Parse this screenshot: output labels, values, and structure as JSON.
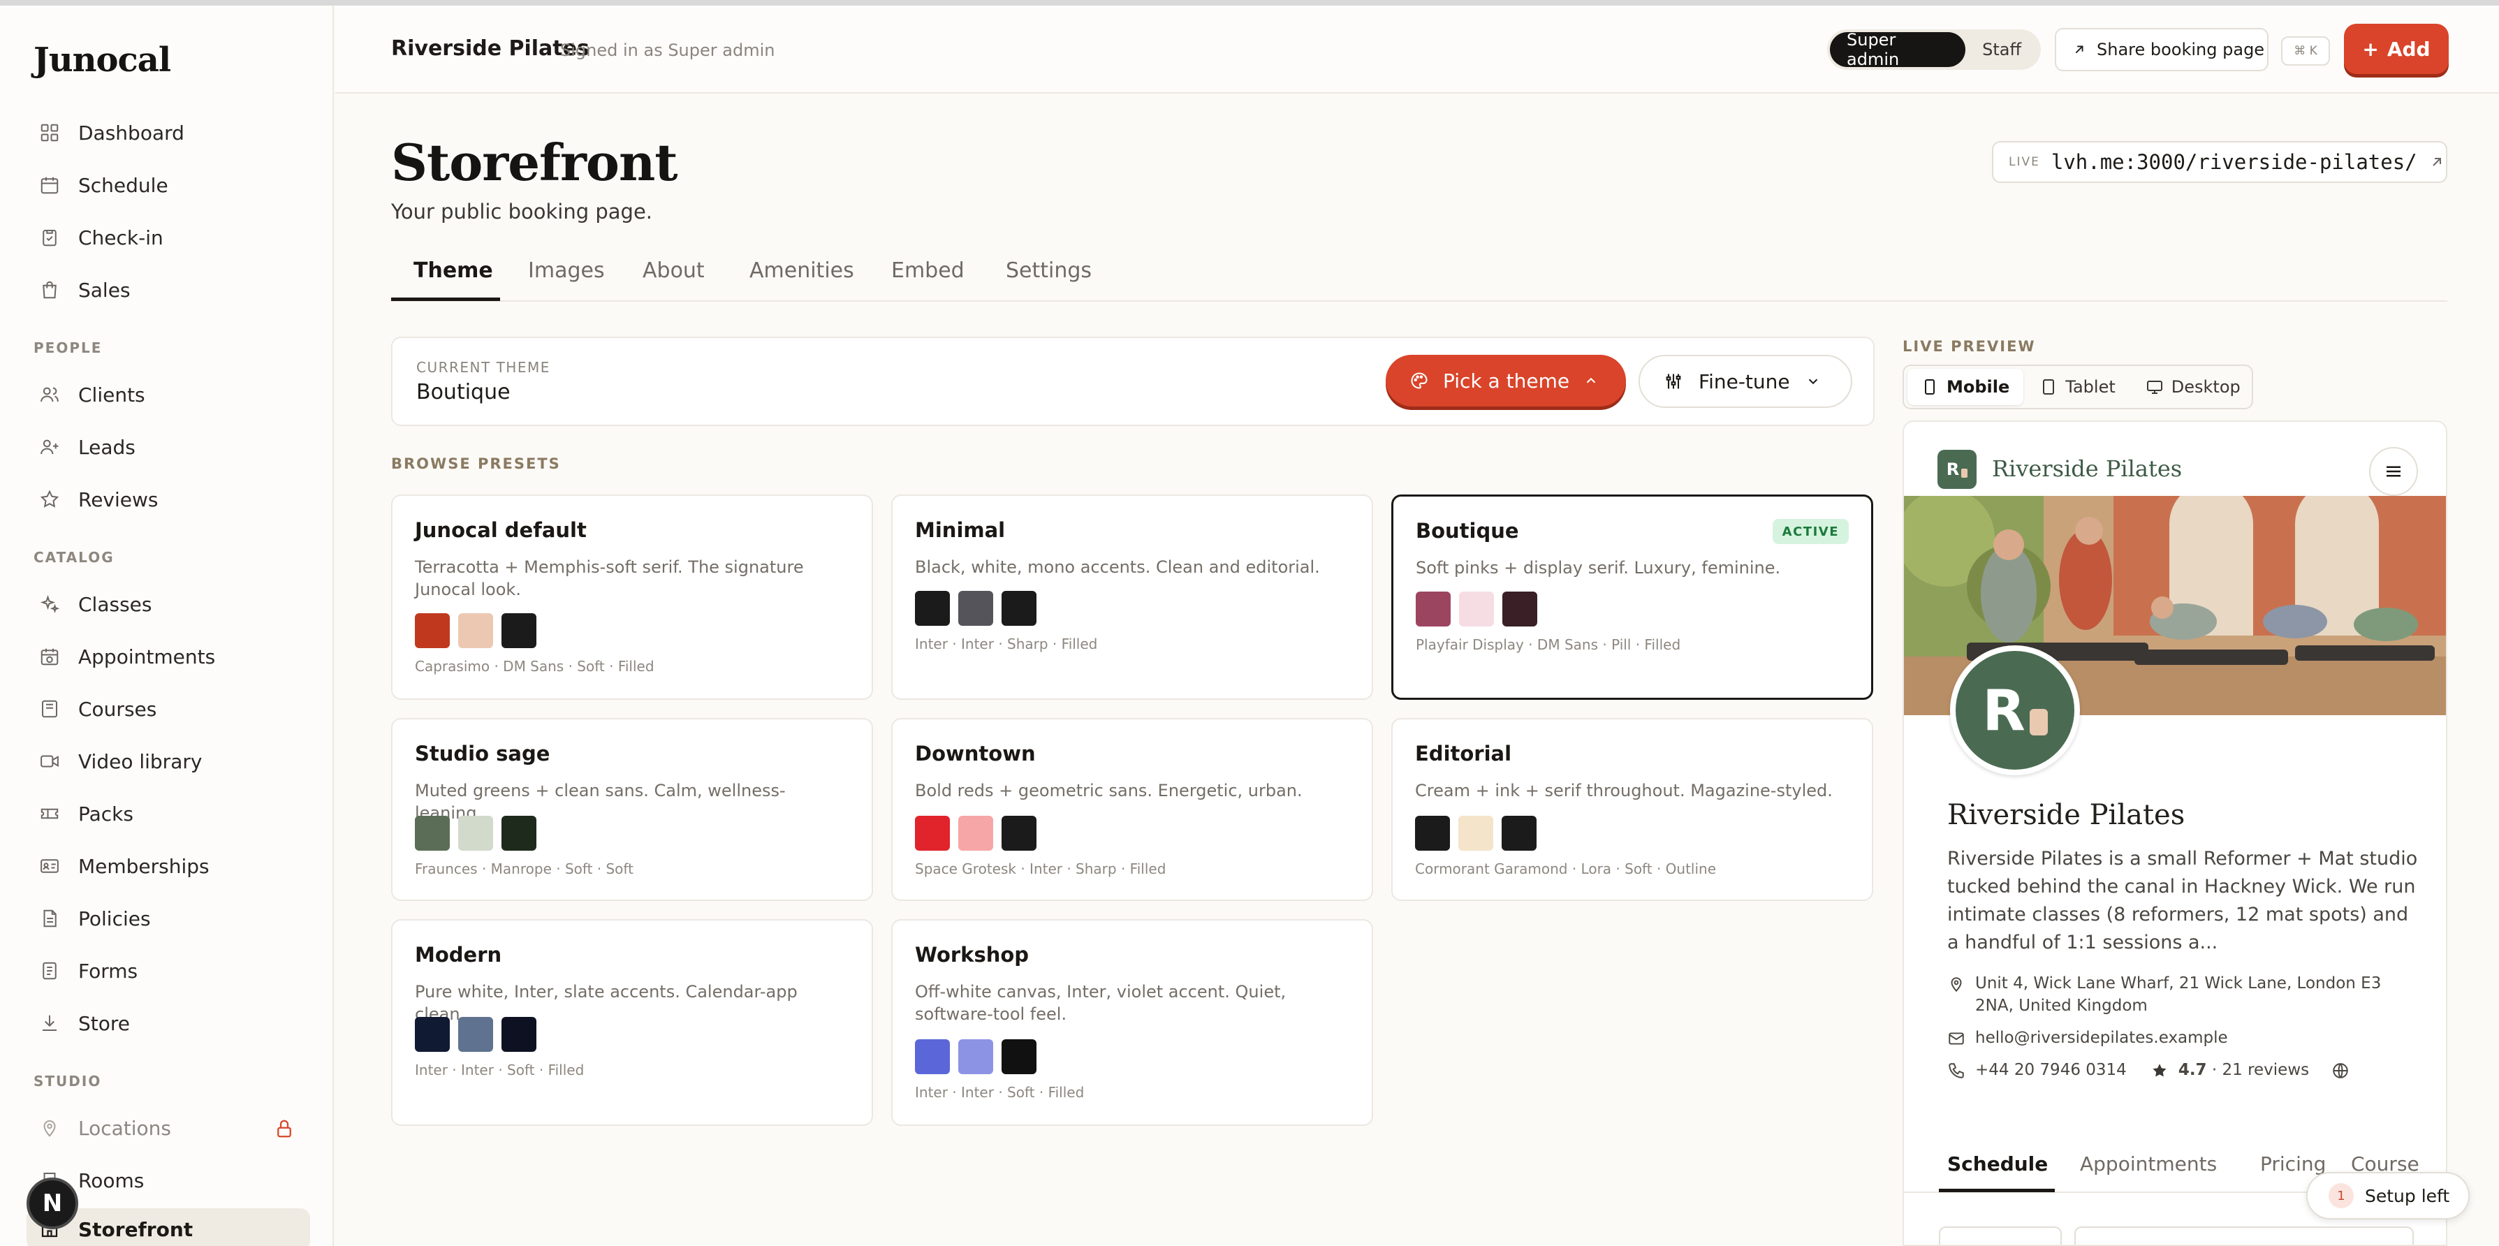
{
  "brand": {
    "logo": "Junocal"
  },
  "sidebar": {
    "items_main": [
      {
        "label": "Dashboard",
        "icon": "dashboard-icon"
      },
      {
        "label": "Schedule",
        "icon": "calendar-icon"
      },
      {
        "label": "Check-in",
        "icon": "clipboard-check-icon"
      },
      {
        "label": "Sales",
        "icon": "shopping-bag-icon"
      }
    ],
    "section_people": "PEOPLE",
    "items_people": [
      {
        "label": "Clients",
        "icon": "users-icon"
      },
      {
        "label": "Leads",
        "icon": "user-plus-icon"
      },
      {
        "label": "Reviews",
        "icon": "star-icon"
      }
    ],
    "section_catalog": "CATALOG",
    "items_catalog": [
      {
        "label": "Classes",
        "icon": "sparkles-icon"
      },
      {
        "label": "Appointments",
        "icon": "calendar-clock-icon"
      },
      {
        "label": "Courses",
        "icon": "book-icon"
      },
      {
        "label": "Video library",
        "icon": "video-icon"
      },
      {
        "label": "Packs",
        "icon": "ticket-icon"
      },
      {
        "label": "Memberships",
        "icon": "id-card-icon"
      },
      {
        "label": "Policies",
        "icon": "document-icon"
      },
      {
        "label": "Forms",
        "icon": "form-icon"
      },
      {
        "label": "Store",
        "icon": "download-icon"
      }
    ],
    "section_studio": "STUDIO",
    "items_studio": [
      {
        "label": "Locations",
        "icon": "map-pin-icon"
      },
      {
        "label": "Rooms",
        "icon": "door-icon"
      },
      {
        "label": "Storefront",
        "icon": "storefront-icon"
      }
    ],
    "fab_letter": "N"
  },
  "header": {
    "org_name": "Riverside Pilates",
    "signed_in": "Signed in as Super admin",
    "roles": [
      "Super admin",
      "Staff"
    ],
    "share_label": "Share booking page",
    "shortcut": "⌘ K",
    "add_label": "Add"
  },
  "page": {
    "title": "Storefront",
    "subtitle": "Your public booking page.",
    "live_tag": "LIVE",
    "live_url": "lvh.me:3000/riverside-pilates/"
  },
  "tabs": [
    "Theme",
    "Images",
    "About",
    "Amenities",
    "Embed",
    "Settings"
  ],
  "current_theme": {
    "label": "CURRENT THEME",
    "value": "Boutique",
    "pick_label": "Pick a theme",
    "finetune_label": "Fine-tune"
  },
  "browse_label": "BROWSE PRESETS",
  "presets": [
    {
      "name": "Junocal default",
      "desc": "Terracotta + Memphis-soft serif. The signature Junocal look.",
      "swatches": [
        "#c0391f",
        "#ecc8b3",
        "#1b1b1b"
      ],
      "meta": [
        "Caprasimo",
        "DM Sans",
        "Soft",
        "Filled"
      ]
    },
    {
      "name": "Minimal",
      "desc": "Black, white, mono accents. Clean and editorial.",
      "swatches": [
        "#1b1b1b",
        "#55545b",
        "#1b1b1b"
      ],
      "meta": [
        "Inter",
        "Inter",
        "Sharp",
        "Filled"
      ]
    },
    {
      "name": "Boutique",
      "desc": "Soft pinks + display serif. Luxury, feminine.",
      "swatches": [
        "#9c4560",
        "#f6dde4",
        "#3a1f26"
      ],
      "meta": [
        "Playfair Display",
        "DM Sans",
        "Pill",
        "Filled"
      ],
      "badge": "ACTIVE"
    },
    {
      "name": "Studio sage",
      "desc": "Muted greens + clean sans. Calm, wellness-leaning.",
      "swatches": [
        "#5b6d56",
        "#d2dacb",
        "#1e2a1b"
      ],
      "meta": [
        "Fraunces",
        "Manrope",
        "Soft",
        "Soft"
      ]
    },
    {
      "name": "Downtown",
      "desc": "Bold reds + geometric sans. Energetic, urban.",
      "swatches": [
        "#e1232c",
        "#f6a6a6",
        "#1b1b1b"
      ],
      "meta": [
        "Space Grotesk",
        "Inter",
        "Sharp",
        "Filled"
      ]
    },
    {
      "name": "Editorial",
      "desc": "Cream + ink + serif throughout. Magazine-styled.",
      "swatches": [
        "#1b1b1b",
        "#f4e4c9",
        "#1b1b1b"
      ],
      "meta": [
        "Cormorant Garamond",
        "Lora",
        "Soft",
        "Outline"
      ]
    },
    {
      "name": "Modern",
      "desc": "Pure white, Inter, slate accents. Calendar-app clean.",
      "swatches": [
        "#111a33",
        "#5f7290",
        "#0d1121"
      ],
      "meta": [
        "Inter",
        "Inter",
        "Soft",
        "Filled"
      ]
    },
    {
      "name": "Workshop",
      "desc": "Off-white canvas, Inter, violet accent. Quiet, software-tool feel.",
      "swatches": [
        "#5b67d8",
        "#8d93e4",
        "#111111"
      ],
      "meta": [
        "Inter",
        "Inter",
        "Soft",
        "Filled"
      ]
    }
  ],
  "preview": {
    "label": "LIVE PREVIEW",
    "devices": [
      "Mobile",
      "Tablet",
      "Desktop"
    ],
    "logo_letters": "R",
    "studio_name": "Riverside Pilates",
    "title": "Riverside Pilates",
    "description": "Riverside Pilates is a small Reformer + Mat studio tucked behind the canal in Hackney Wick. We run intimate classes (8 reformers, 12 mat spots) and a handful of 1:1 sessions a...",
    "address": "Unit 4, Wick Lane Wharf, 21 Wick Lane, London E3 2NA, United Kingdom",
    "email": "hello@riversidepilates.example",
    "phone": "+44 20 7946 0314",
    "rating": "4.7",
    "reviews": "· 21 reviews",
    "tabs": [
      "Schedule",
      "Appointments",
      "Pricing",
      "Course"
    ]
  },
  "setup": {
    "count": "1",
    "label": "Setup left"
  },
  "colors": {
    "accent": "#d9442a",
    "brand_green": "#4a6b52"
  }
}
